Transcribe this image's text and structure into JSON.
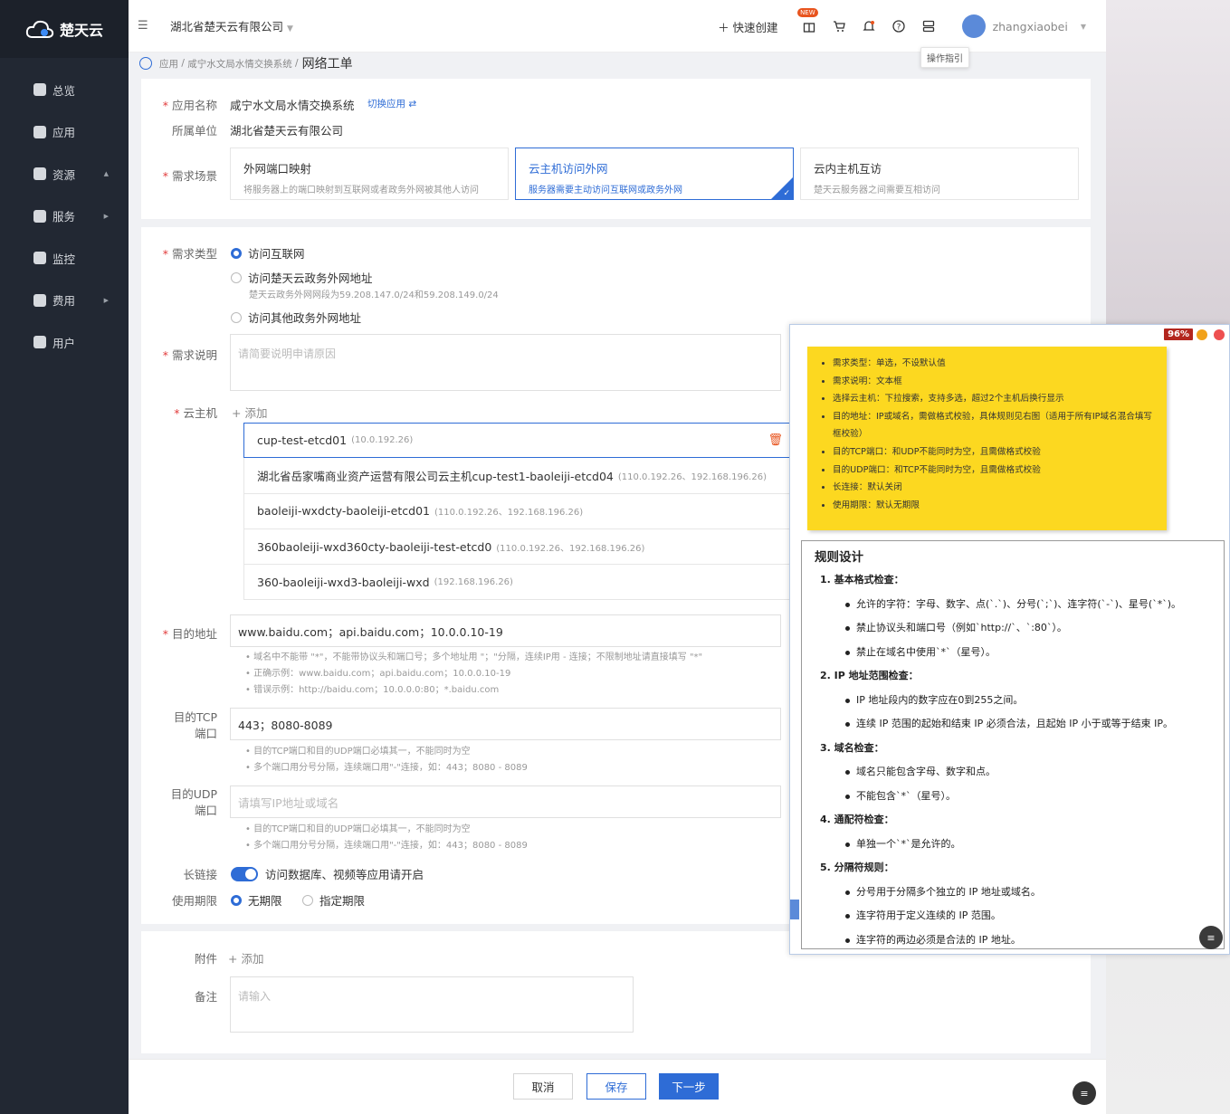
{
  "brand": {
    "name": "楚天云"
  },
  "nav": [
    {
      "label": "总览",
      "icon": "pie-chart-icon",
      "arrow": ""
    },
    {
      "label": "应用",
      "icon": "grid-icon",
      "arrow": ""
    },
    {
      "label": "资源",
      "icon": "network-icon",
      "arrow": "▲"
    },
    {
      "label": "服务",
      "icon": "bookmark-icon",
      "arrow": "▶"
    },
    {
      "label": "监控",
      "icon": "monitor-icon",
      "arrow": ""
    },
    {
      "label": "费用",
      "icon": "coin-icon",
      "arrow": "▶"
    },
    {
      "label": "用户",
      "icon": "user-icon",
      "arrow": ""
    }
  ],
  "topbar": {
    "org": "湖北省楚天云有限公司",
    "quick_create": "快速创建",
    "new_badge": "NEW",
    "username": "zhangxiaobei",
    "tooltip": "操作指引"
  },
  "breadcrumb": {
    "root": "应用",
    "app": "咸宁水文局水情交换系统",
    "current": "网络工单"
  },
  "form": {
    "app_name_label": "应用名称",
    "app_name": "咸宁水文局水情交换系统",
    "switch_app": "切换应用 ⇄",
    "unit_label": "所属单位",
    "unit": "湖北省楚天云有限公司",
    "scene_label": "需求场景",
    "scenes": [
      {
        "title": "外网端口映射",
        "desc": "将服务器上的端口映射到互联网或者政务外网被其他人访问"
      },
      {
        "title": "云主机访问外网",
        "desc": "服务器需要主动访问互联网或政务外网"
      },
      {
        "title": "云内主机互访",
        "desc": "楚天云服务器之间需要互相访问"
      }
    ],
    "type_label": "需求类型",
    "types": [
      {
        "label": "访问互联网",
        "sub": ""
      },
      {
        "label": "访问楚天云政务外网地址",
        "sub": "楚天云政务外网网段为59.208.147.0/24和59.208.149.0/24"
      },
      {
        "label": "访问其他政务外网地址",
        "sub": ""
      }
    ],
    "desc_label": "需求说明",
    "desc_placeholder": "请简要说明申请原因",
    "host_label": "云主机",
    "add": "+ 添加",
    "hosts": [
      {
        "name": "cup-test-etcd01",
        "ip": "(10.0.192.26)"
      },
      {
        "name": "湖北省岳家嘴商业资产运营有限公司云主机cup-test1-baoleiji-etcd04",
        "ip": "(110.0.192.26、192.168.196.26)"
      },
      {
        "name": "baoleiji-wxdcty-baoleiji-etcd01",
        "ip": "(110.0.192.26、192.168.196.26)"
      },
      {
        "name": "360baoleiji-wxd360cty-baoleiji-test-etcd0",
        "ip": "(110.0.192.26、192.168.196.26)"
      },
      {
        "name": "360-baoleiji-wxd3-baoleiji-wxd",
        "ip": "(192.168.196.26)"
      }
    ],
    "dest_label": "目的地址",
    "dest_value": "www.baidu.com；api.baidu.com；10.0.0.10-19",
    "dest_hints": [
      "• 域名中不能带 \"*\"，不能带协议头和端口号；多个地址用 \"；\"分隔，连续IP用 - 连接；不限制地址请直接填写 \"*\"",
      "• 正确示例：www.baidu.com；api.baidu.com；10.0.0.10-19",
      "• 错误示例：http://baidu.com；10.0.0.0:80；*.baidu.com"
    ],
    "tcp_label1": "目的TCP",
    "tcp_label2": "端口",
    "tcp_value": "443；8080-8089",
    "port_hints": [
      "• 目的TCP端口和目的UDP端口必填其一，不能同时为空",
      "• 多个端口用分号分隔，连续端口用\"-\"连接，如：443；8080 - 8089"
    ],
    "udp_label1": "目的UDP",
    "udp_label2": "端口",
    "udp_placeholder": "请填写IP地址或域名",
    "keepalive_label": "长链接",
    "keepalive_text": "访问数据库、视频等应用请开启",
    "period_label": "使用期限",
    "period_opts": [
      "无期限",
      "指定期限"
    ],
    "attach_label": "附件",
    "remark_label": "备注",
    "remark_placeholder": "请输入"
  },
  "footer": {
    "cancel": "取消",
    "save": "保存",
    "next": "下一步"
  },
  "overlay": {
    "zoom": "96%",
    "notes": [
      "需求类型：单选，不设默认值",
      "需求说明：文本框",
      "选择云主机：下拉搜索，支持多选，超过2个主机后换行显示",
      "目的地址：IP或域名，需做格式校验，具体规则见右图（适用于所有IP域名混合填写框校验）",
      "目的TCP端口：和UDP不能同时为空，且需做格式校验",
      "目的UDP端口：和TCP不能同时为空，且需做格式校验",
      "长连接：默认关闭",
      "使用期限：默认无期限"
    ],
    "rules_title": "规则设计",
    "rules": [
      {
        "title": "1.  基本格式检查：",
        "items": [
          "允许的字符：字母、数字、点(`.`)、分号(`;`)、连字符(`-`)、星号(`*`)。",
          "禁止协议头和端口号（例如`http://`、`:80`）。",
          "禁止在域名中使用`*`（星号）。"
        ]
      },
      {
        "title": "2.  IP 地址范围检查：",
        "items": [
          "IP 地址段内的数字应在0到255之间。",
          "连续 IP 范围的起始和结束 IP 必须合法，且起始 IP 小于或等于结束 IP。"
        ]
      },
      {
        "title": "3.  域名检查：",
        "items": [
          "域名只能包含字母、数字和点。",
          "不能包含`*`（星号）。"
        ]
      },
      {
        "title": "4.  通配符检查：",
        "items": [
          "单独一个`*`是允许的。"
        ]
      },
      {
        "title": "5.  分隔符规则：",
        "items": [
          "分号用于分隔多个独立的 IP 地址或域名。",
          "连字符用于定义连续的 IP 范围。",
          "连字符的两边必须是合法的 IP 地址。"
        ]
      }
    ]
  }
}
